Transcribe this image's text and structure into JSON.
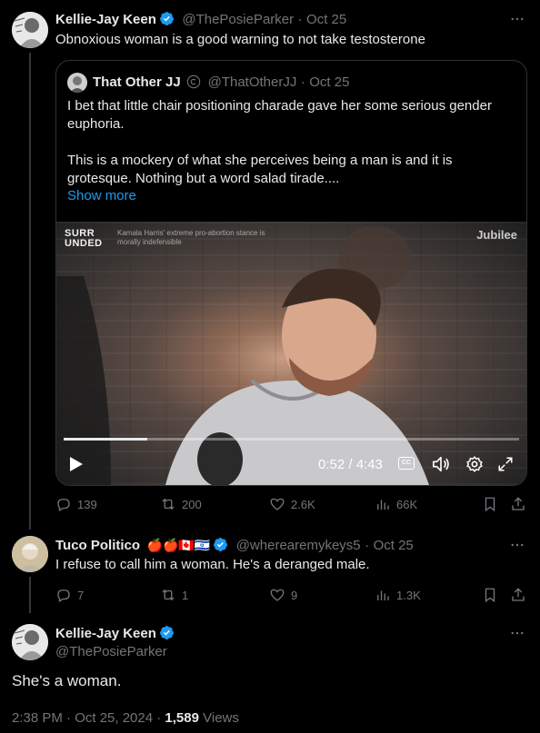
{
  "tweet1": {
    "name": "Kellie-Jay Keen",
    "handle": "@ThePosieParker",
    "date": "Oct 25",
    "dot": "·",
    "text": "Obnoxious woman is a good warning to not take testosterone"
  },
  "quote": {
    "name": "That Other JJ",
    "handle": "@ThatOtherJJ",
    "date": "Oct 25",
    "dot": "·",
    "text1": "I bet that little chair positioning charade gave her some serious gender euphoria.",
    "text2": "This is a mockery of what she perceives being a man is and it is grotesque. Nothing but a word salad tirade....",
    "show_more": "Show more",
    "video": {
      "brand_line1": "SURR",
      "brand_line2": "UNDED",
      "caption": "Kamala Harris' extreme pro-abortion stance is morally indefensible",
      "watermark": "Jubilee",
      "time": "0:52 / 4:43",
      "progress": 0.184,
      "cc_label": "CC"
    }
  },
  "tweet1_actions": {
    "replies": "139",
    "reposts": "200",
    "likes": "2.6K",
    "views": "66K"
  },
  "tweet2": {
    "name": "Tuco Politico",
    "emojis": "🍎🍎🇨🇦🇮🇱",
    "handle": "@wherearemykeys5",
    "date": "Oct 25",
    "dot": "·",
    "text": "I refuse to call him a woman. He's a deranged male.",
    "replies": "7",
    "reposts": "1",
    "likes": "9",
    "views": "1.3K"
  },
  "tweet3": {
    "name": "Kellie-Jay Keen",
    "handle": "@ThePosieParker",
    "text": "She's a woman.",
    "timestamp": "2:38 PM · Oct 25, 2024 · ",
    "views_count": "1,589",
    "views_label": " Views"
  },
  "colors": {
    "background": "#000000",
    "text": "#e7e9ea",
    "secondary": "#71767b",
    "link": "#1d9bf0",
    "verified": "#1d9bf0",
    "border": "#2f3336"
  },
  "icons": [
    "verified-badge-icon",
    "more-icon",
    "reply-icon",
    "repost-icon",
    "like-icon",
    "views-icon",
    "bookmark-icon",
    "share-icon",
    "play-icon",
    "captions-icon",
    "volume-icon",
    "settings-icon",
    "fullscreen-icon"
  ]
}
